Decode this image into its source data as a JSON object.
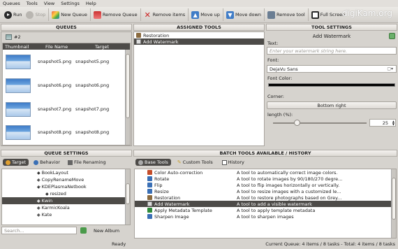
{
  "menu": [
    "Queues",
    "Tools",
    "View",
    "Settings",
    "Help"
  ],
  "toolbar": {
    "run": "Run",
    "stop": "Stop",
    "new_queue": "New Queue",
    "remove_queue": "Remove Queue",
    "remove_items": "Remove items",
    "move_up": "Move up",
    "move_down": "Move down",
    "remove_tool": "Remove tool",
    "full_screen": "Full Screen",
    "logo": "digiKam.org"
  },
  "queues": {
    "title": "QUEUES",
    "tab_label": "#2",
    "columns": [
      "Thumbnail",
      "File Name",
      "Target"
    ],
    "items": [
      {
        "file": "snapshot5.png",
        "target": "snapshot5.png"
      },
      {
        "file": "snapshot6.png",
        "target": "snapshot6.png"
      },
      {
        "file": "snapshot7.png",
        "target": "snapshot7.png"
      },
      {
        "file": "snapshot8.png",
        "target": "snapshot8.png"
      }
    ]
  },
  "assigned_tools": {
    "title": "ASSIGNED TOOLS",
    "items": [
      "Restoration",
      "Add Watermark"
    ]
  },
  "tool_settings": {
    "title": "TOOL SETTINGS",
    "tool_name": "Add Watermark",
    "text_label": "Text:",
    "text_placeholder": "Enter your watermark string here.",
    "font_label": "Font:",
    "font_value": "DejaVu Sans",
    "font_color_label": "Font Color:",
    "corner_label": "Corner:",
    "corner_value": "Bottom right",
    "length_label": "length (%):",
    "length_value": "25",
    "length_fraction": 0.25,
    "font_color": "#000000"
  },
  "queue_settings": {
    "title": "QUEUE SETTINGS",
    "tabs": [
      "Target",
      "Behavior",
      "File Renaming"
    ],
    "tree": [
      {
        "label": "BookLayout",
        "indent": 1,
        "arrow": ""
      },
      {
        "label": "CopyRenameMove",
        "indent": 1,
        "arrow": "▸"
      },
      {
        "label": "KDEPlasmaNetbook",
        "indent": 1,
        "arrow": "▾"
      },
      {
        "label": "resized",
        "indent": 2,
        "arrow": ""
      },
      {
        "label": "Kwin",
        "indent": 1,
        "arrow": "▸",
        "selected": true
      },
      {
        "label": "KarmicKoala",
        "indent": 1,
        "arrow": "▸"
      },
      {
        "label": "Kate",
        "indent": 1,
        "arrow": "▸"
      }
    ],
    "search_placeholder": "Search...",
    "new_album": "New Album"
  },
  "batch_tools": {
    "title": "BATCH TOOLS AVAILABLE / HISTORY",
    "tabs": [
      "Base Tools",
      "Custom Tools",
      "History"
    ],
    "items": [
      {
        "name": "Color Auto-correction",
        "desc": "A tool to automatically correct image colors.",
        "color": "#c44d2a"
      },
      {
        "name": "Rotate",
        "desc": "A tool to rotate images by 90/180/270 degre...",
        "color": "#3a6fb5"
      },
      {
        "name": "Flip",
        "desc": "A tool to flip images horizontally or vertically.",
        "color": "#3a6fb5"
      },
      {
        "name": "Resize",
        "desc": "A tool to resize images with a customized le...",
        "color": "#3a6fb5"
      },
      {
        "name": "Restoration",
        "desc": "A tool to restore photographs based on Grey...",
        "color": "#8a6a3e"
      },
      {
        "name": "Add Watermark",
        "desc": "A tool to add a visible watermark",
        "color": "#555555",
        "selected": true
      },
      {
        "name": "Apply Metadata Template",
        "desc": "A tool to apply template metadata",
        "color": "#2f8a3a"
      },
      {
        "name": "Sharpen Image",
        "desc": "A tool to sharpen images",
        "color": "#3a6fb5"
      }
    ]
  },
  "status": {
    "state": "Ready",
    "summary": "Current Queue: 4 items / 8 tasks - Total: 4 items / 8 tasks"
  }
}
